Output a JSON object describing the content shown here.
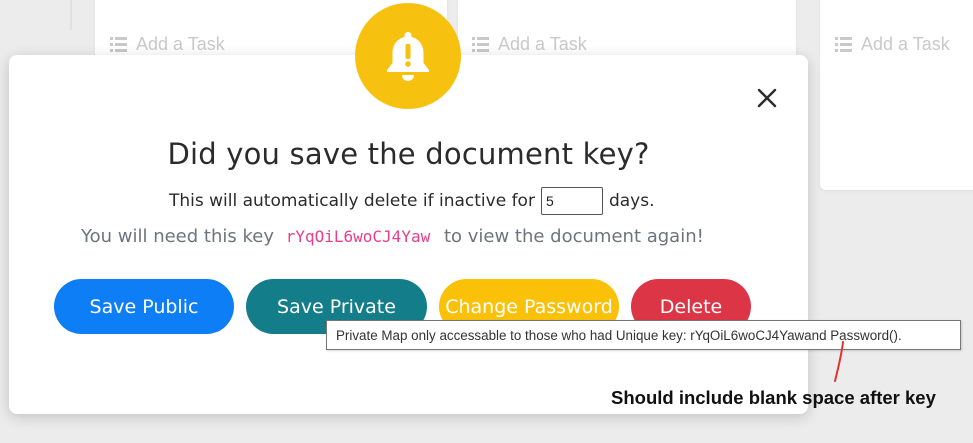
{
  "board": {
    "columns": [
      {
        "add_task_label": "Add a Task"
      },
      {
        "add_task_label": "Add a Task"
      },
      {
        "add_task_label": "Add a Task"
      }
    ]
  },
  "modal": {
    "icon": "bell-exclamation-icon",
    "accent_color": "#f7c10f",
    "title": "Did you save the document key?",
    "inactive_prefix": "This will automatically delete if inactive for",
    "inactive_days": "5",
    "inactive_suffix": "days.",
    "key_prefix": "You will need this key",
    "key_value": "rYqOiL6woCJ4Yaw",
    "key_suffix": "to view the document again!",
    "buttons": {
      "save_public": "Save Public",
      "save_private": "Save Private",
      "change_password": "Change Password",
      "delete": "Delete"
    }
  },
  "tooltip": {
    "text": "Private Map only accessable to those who had Unique key: rYqOiL6woCJ4Yawand Password()."
  },
  "annotation": {
    "note": "Should include blank space after key",
    "color": "#e3342f"
  },
  "colors": {
    "primary": "#0d7ef5",
    "teal": "#137d8a",
    "warning": "#fbc108",
    "danger": "#dc3545",
    "key_pink": "#e83e8c"
  }
}
